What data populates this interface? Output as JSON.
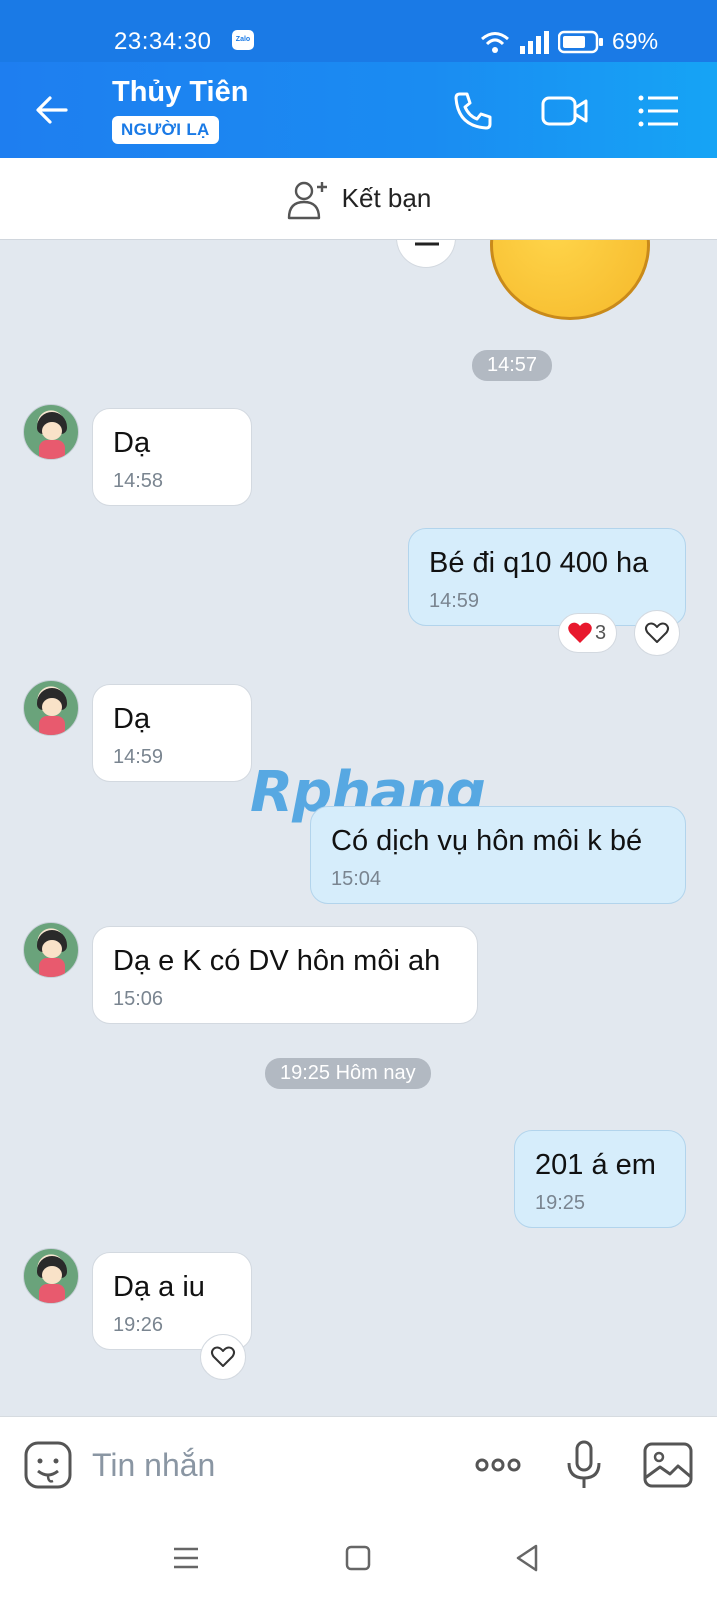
{
  "status": {
    "time": "23:34:30",
    "app_badge": "Zalo",
    "battery": "69%"
  },
  "header": {
    "contact_name": "Thủy Tiên",
    "tag": "NGƯỜI LẠ",
    "icons": [
      "back-arrow-icon",
      "phone-icon",
      "video-call-icon",
      "menu-list-icon"
    ]
  },
  "add_friend": {
    "label": "Kết bạn"
  },
  "chat": {
    "time_separators": [
      "14:57",
      "19:25 Hôm nay"
    ],
    "messages": [
      {
        "side": "in",
        "text": "Dạ",
        "time": "14:58"
      },
      {
        "side": "out",
        "text": "Bé đi q10 400 ha",
        "time": "14:59",
        "reaction_count": "3"
      },
      {
        "side": "in",
        "text": "Dạ",
        "time": "14:59"
      },
      {
        "side": "out",
        "text": "Có dịch vụ hôn môi k bé",
        "time": "15:04"
      },
      {
        "side": "in",
        "text": "Dạ e K có DV hôn môi ah",
        "time": "15:06"
      },
      {
        "side": "out",
        "text": "201 á em",
        "time": "19:25"
      },
      {
        "side": "in",
        "text": "Dạ a iu",
        "time": "19:26"
      }
    ],
    "watermark": "Rphang"
  },
  "input": {
    "placeholder": "Tin nhắn"
  },
  "colors": {
    "header_blue": "#1a7ae6",
    "chat_bg": "#e2e8ef",
    "out_bubble": "#d6edfb",
    "in_bubble": "#ffffff"
  }
}
